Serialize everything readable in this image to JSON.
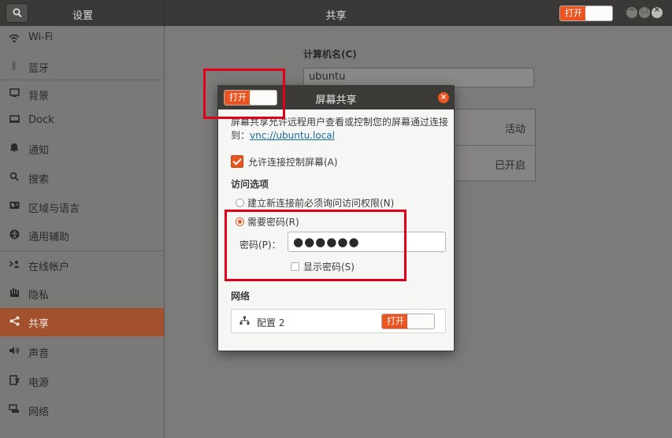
{
  "header": {
    "app_title": "设置",
    "panel_title": "共享",
    "toggle_label": "打开",
    "win_minimize": "−",
    "win_maximize": "□",
    "win_close": "×"
  },
  "sidebar": {
    "items": [
      {
        "label": "Wi-Fi",
        "icon": "wifi-icon"
      },
      {
        "label": "蓝牙",
        "icon": "bluetooth-icon"
      },
      {
        "label": "背景",
        "icon": "background-icon"
      },
      {
        "label": "Dock",
        "icon": "dock-icon"
      },
      {
        "label": "通知",
        "icon": "bell-icon"
      },
      {
        "label": "搜索",
        "icon": "search-icon"
      },
      {
        "label": "区域与语言",
        "icon": "region-icon"
      },
      {
        "label": "通用辅助",
        "icon": "accessibility-icon"
      },
      {
        "label": "在线帐户",
        "icon": "online-accounts-icon"
      },
      {
        "label": "隐私",
        "icon": "hand-icon"
      },
      {
        "label": "共享",
        "icon": "share-icon",
        "active": true
      },
      {
        "label": "声音",
        "icon": "speaker-icon"
      },
      {
        "label": "电源",
        "icon": "power-icon"
      },
      {
        "label": "网络",
        "icon": "network-icon"
      }
    ]
  },
  "main": {
    "computer_name_label": "计算机名(C)",
    "computer_name_value": "ubuntu",
    "services": [
      {
        "status": "活动"
      },
      {
        "status": "已开启"
      }
    ]
  },
  "dialog": {
    "title": "屏幕共享",
    "toggle_label": "打开",
    "description": "屏幕共享允许远程用户查看或控制您的屏幕通过连接到：",
    "link": "vnc://ubuntu.local",
    "allow_control_label": "允许连接控制屏幕(A)",
    "allow_control_checked": true,
    "access_options_label": "访问选项",
    "radio_new_connection": "建立新连接前必须询问访问权限(N)",
    "radio_require_password": "需要密码(R)",
    "selected_option": "require_password",
    "password_label": "密码(P)：",
    "password_value": "●●●●●●",
    "show_password_label": "显示密码(S)",
    "show_password_checked": false,
    "network_label": "网络",
    "network_config_name": "配置 2",
    "network_toggle_label": "打开"
  },
  "colors": {
    "accent": "#e95420",
    "highlight": "#e10019",
    "header_bg": "#3a3937"
  }
}
